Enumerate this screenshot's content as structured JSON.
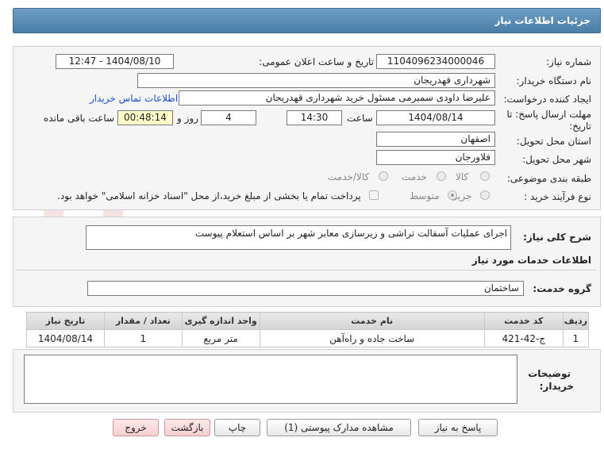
{
  "header": {
    "title": "جزئیات اطلاعات نیاز"
  },
  "form": {
    "need_number_label": "شماره نیاز:",
    "need_number": "1104096234000046",
    "announce_label": "تاریخ و ساعت اعلان عمومی:",
    "announce_value": "1404/08/10 - 12:47",
    "buyer_org_label": "نام دستگاه خریدار:",
    "buyer_org": "شهرداری قهدریجان",
    "creator_label": "ایجاد کننده درخواست:",
    "creator": "علیرضا داودی سمیرمی مسئول خرید  شهرداری قهدریجان",
    "contact_link": "اطلاعات تماس خریدار",
    "deadline_label_1": "مهلت ارسال پاسخ: تا",
    "deadline_label_2": "تاریخ:",
    "deadline_date": "1404/08/14",
    "time_label": "ساعت",
    "deadline_time": "14:30",
    "days_value": "4",
    "days_label": "روز و",
    "remaining_time": "00:48:14",
    "remaining_label": "ساعت باقی مانده",
    "province_label": "استان محل تحویل:",
    "province": "اصفهان",
    "city_label": "شهر محل تحویل:",
    "city": "فلاورجان",
    "category_label": "طبقه بندی موضوعی:",
    "category_options": [
      "کالا",
      "خدمت",
      "کالا/خدمت"
    ],
    "process_label": "نوع فرآیند خرید :",
    "process_options": [
      "جزیی",
      "متوسط"
    ],
    "payment_note": "پرداخت تمام یا بخشی از مبلغ خرید،از محل \"اسناد خزانه اسلامی\" خواهد بود."
  },
  "description": {
    "label": "شرح کلی نیاز:",
    "value": "اجرای عملیات آسفالت تراشی و زیرسازی معابر شهر بر اساس استعلام پیوست"
  },
  "services": {
    "section_title": "اطلاعات خدمات مورد نیاز",
    "group_label": "گروه خدمت:",
    "group_value": "ساختمان",
    "columns": [
      "ردیف",
      "کد خدمت",
      "نام خدمت",
      "واحد اندازه گیری",
      "تعداد / مقدار",
      "تاریخ نیاز"
    ],
    "rows": [
      [
        "1",
        "ج-42-421",
        "ساخت جاده و راه‌آهن",
        "متر مربع",
        "1",
        "1404/08/14"
      ]
    ]
  },
  "buyer_notes": {
    "label_1": "توضیحات",
    "label_2": "خریدار:"
  },
  "buttons": {
    "reply": "پاسخ به نیاز",
    "attachments": "مشاهده مدارک پیوستی (1)",
    "print": "چاپ",
    "back": "بازگشت",
    "exit": "خروج"
  },
  "watermark": {
    "text": "AriaTender.net"
  },
  "colors": {
    "header": "#5b8db5",
    "link": "#1a4fd0",
    "remaining_bg": "#ffffcc",
    "back_exit_bg": "#f6cfcf"
  }
}
